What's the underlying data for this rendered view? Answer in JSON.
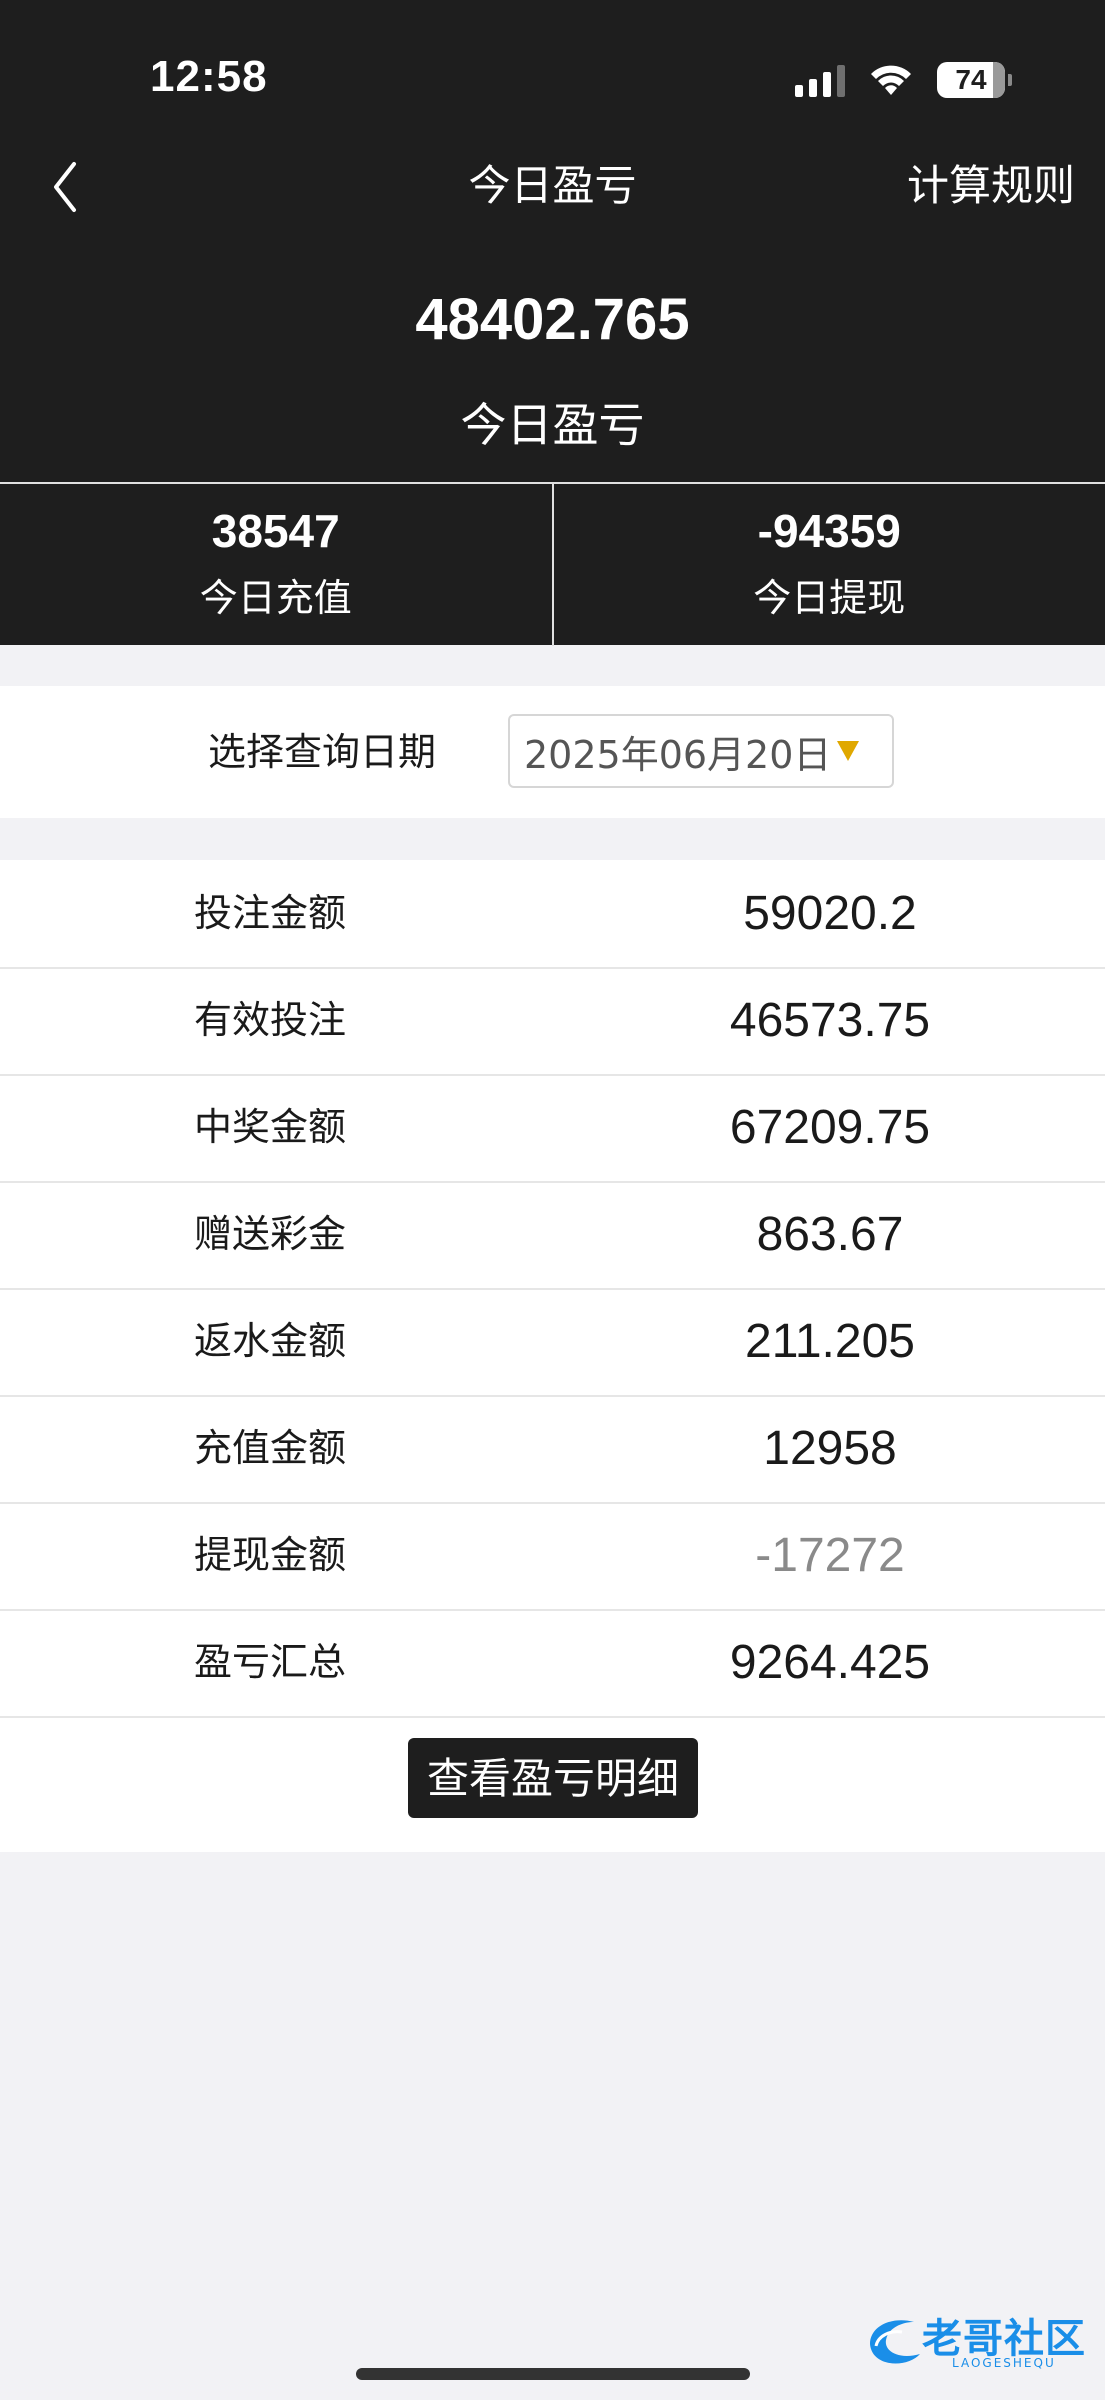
{
  "status_bar": {
    "time": "12:58",
    "battery": "74",
    "icons": [
      "signal-icon",
      "wifi-icon",
      "battery-icon"
    ]
  },
  "nav": {
    "back_icon": "chevron-left-icon",
    "title": "今日盈亏",
    "rules_label": "计算规则"
  },
  "summary_header": {
    "total_value": "48402.765",
    "total_label": "今日盈亏",
    "recharge_value": "38547",
    "recharge_label": "今日充值",
    "withdraw_value": "-94359",
    "withdraw_label": "今日提现"
  },
  "date_filter": {
    "label": "选择查询日期",
    "value": "2025年06月20日",
    "caret_icon": "caret-down-icon",
    "caret_color": "#e0a800"
  },
  "rows": [
    {
      "label": "投注金额",
      "value": "59020.2"
    },
    {
      "label": "有效投注",
      "value": "46573.75"
    },
    {
      "label": "中奖金额",
      "value": "67209.75"
    },
    {
      "label": "赠送彩金",
      "value": "863.67"
    },
    {
      "label": "返水金额",
      "value": "211.205"
    },
    {
      "label": "充值金额",
      "value": "12958"
    },
    {
      "label": "提现金额",
      "value": "-17272"
    },
    {
      "label": "盈亏汇总",
      "value": "9264.425"
    }
  ],
  "detail_button": "查看盈亏明细",
  "watermark": {
    "text": "老哥社区",
    "sub": "LAOGESHEQU"
  },
  "colors": {
    "header_bg": "#1e1e1e",
    "page_bg": "#f2f2f5",
    "muted_value": "#8a8a8a",
    "watermark": "#1a8ee8"
  }
}
